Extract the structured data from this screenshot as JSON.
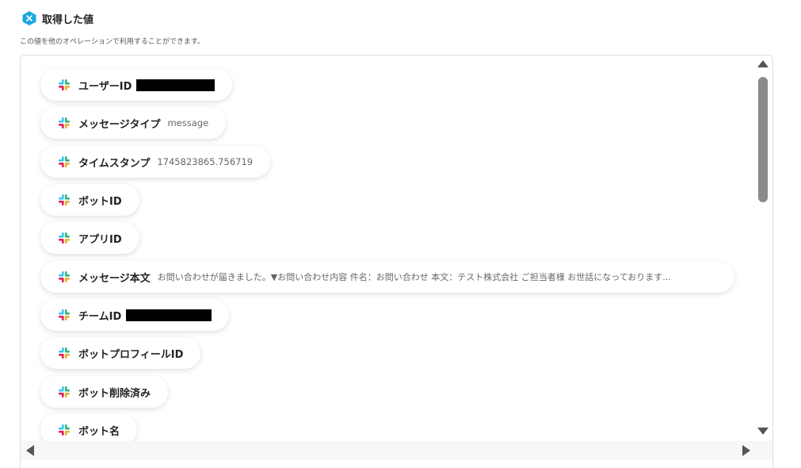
{
  "header": {
    "title": "取得した値",
    "description": "この値を他のオペレーションで利用することができます。"
  },
  "colors": {
    "brand": "#1aa7e0",
    "slack_blue": "#36c5f0",
    "slack_green": "#2eb67d",
    "slack_yellow": "#ecb22e",
    "slack_red": "#e01e5a"
  },
  "icons": {
    "header": "yoom-logo-icon",
    "items": "slack-icon"
  },
  "items": [
    {
      "label": "ユーザーID",
      "value": "",
      "redacted": true
    },
    {
      "label": "メッセージタイプ",
      "value": "message"
    },
    {
      "label": "タイムスタンプ",
      "value": "1745823865.756719"
    },
    {
      "label": "ボットID",
      "value": ""
    },
    {
      "label": "アプリID",
      "value": ""
    },
    {
      "label": "メッセージ本文",
      "value": "お問い合わせが届きました。▼お問い合わせ内容 件名：お問い合わせ 本文：テスト株式会社 ご担当者様 お世話になっております..."
    },
    {
      "label": "チームID",
      "value": "",
      "redacted": true
    },
    {
      "label": "ボットプロフィールID",
      "value": ""
    },
    {
      "label": "ボット削除済み",
      "value": ""
    },
    {
      "label": "ボット名",
      "value": ""
    }
  ]
}
